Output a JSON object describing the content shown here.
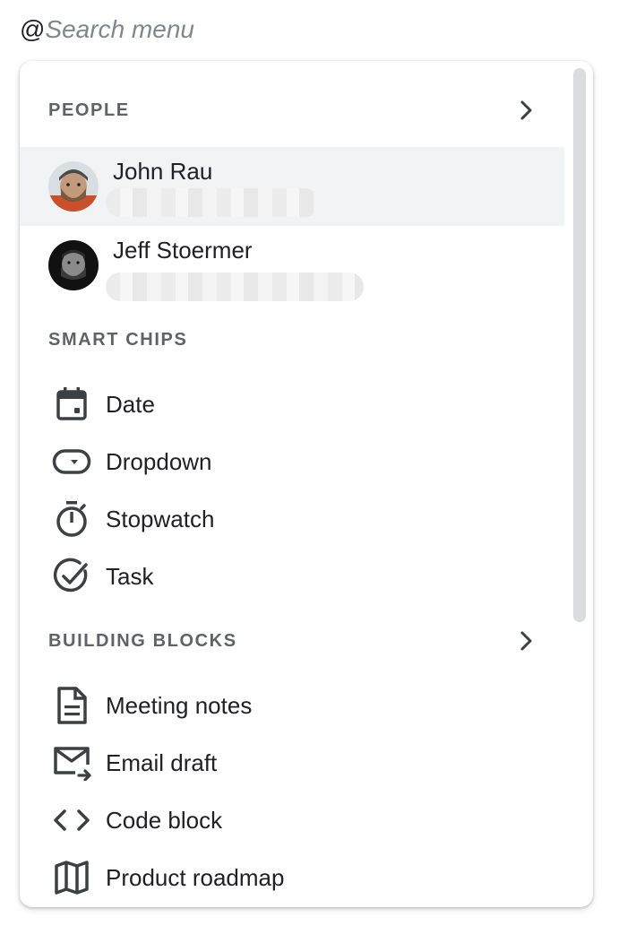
{
  "search": {
    "prefix": "@",
    "placeholder": "Search menu"
  },
  "sections": {
    "people": {
      "title": "PEOPLE",
      "items": [
        {
          "name": "John Rau",
          "avatar_icon": "user-avatar-photo",
          "email_redacted": true,
          "highlighted": true
        },
        {
          "name": "Jeff Stoermer",
          "avatar_icon": "user-avatar-photo",
          "email_redacted": true,
          "highlighted": false
        }
      ]
    },
    "smart_chips": {
      "title": "SMART CHIPS",
      "items": [
        {
          "label": "Date",
          "icon": "calendar-icon"
        },
        {
          "label": "Dropdown",
          "icon": "dropdown-chip-icon"
        },
        {
          "label": "Stopwatch",
          "icon": "stopwatch-icon"
        },
        {
          "label": "Task",
          "icon": "task-check-icon"
        }
      ]
    },
    "building_blocks": {
      "title": "BUILDING BLOCKS",
      "items": [
        {
          "label": "Meeting notes",
          "icon": "document-icon"
        },
        {
          "label": "Email draft",
          "icon": "email-draft-icon"
        },
        {
          "label": "Code block",
          "icon": "code-icon"
        },
        {
          "label": "Product roadmap",
          "icon": "map-icon"
        }
      ]
    }
  },
  "colors": {
    "text": "#202124",
    "section_title": "#5f6368",
    "icon": "#3c4043",
    "highlight": "#f1f3f4",
    "scrollbar": "#dadce0"
  }
}
